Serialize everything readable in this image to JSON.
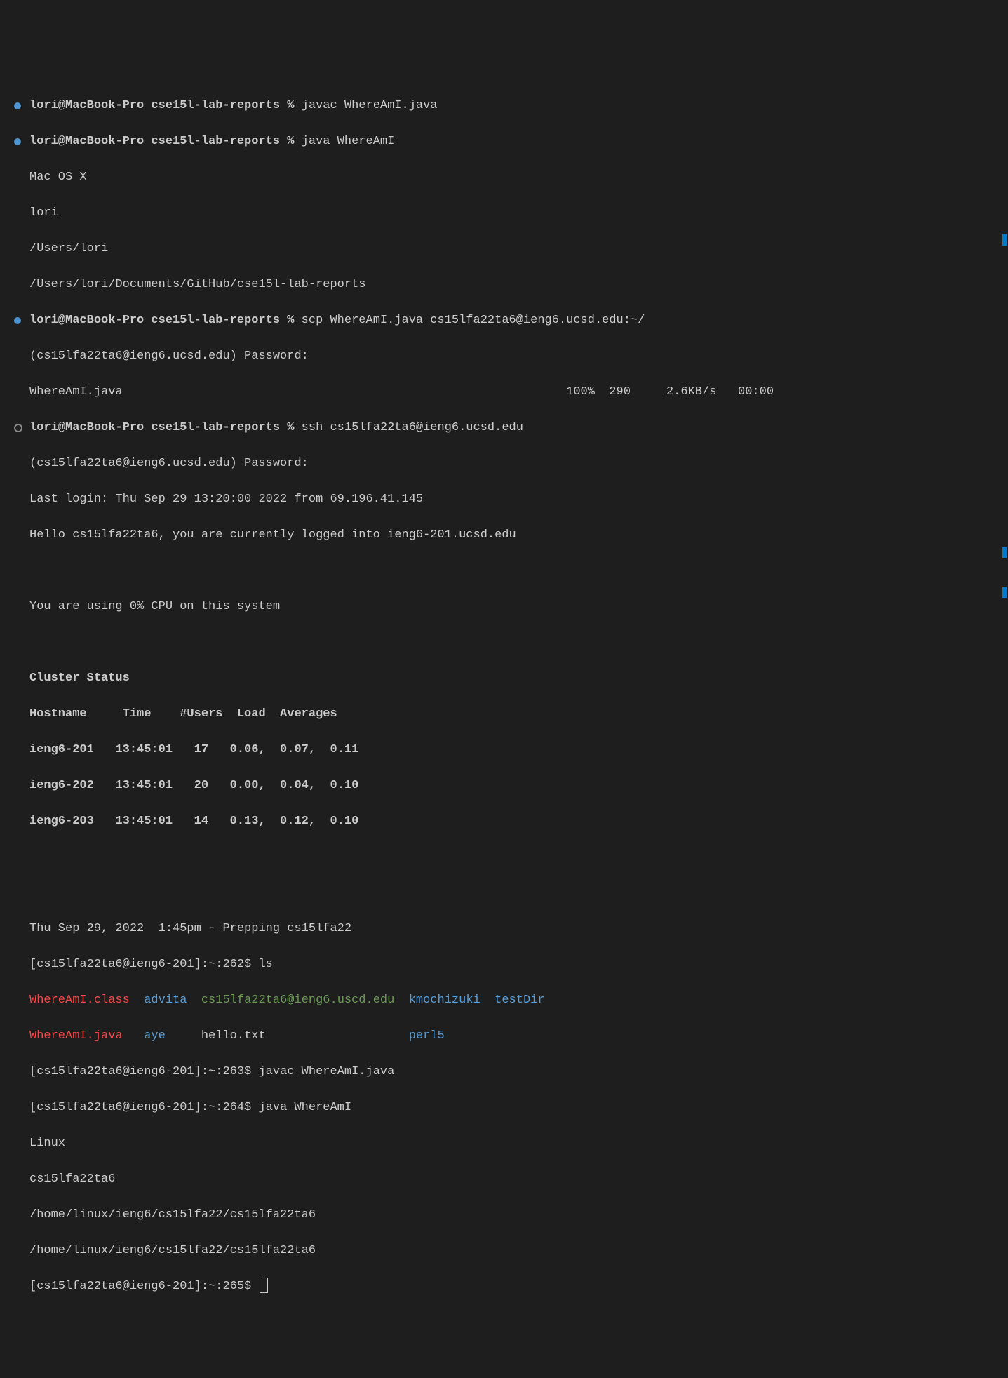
{
  "local_prompt": "lori@MacBook-Pro cse15l-lab-reports %",
  "commands": {
    "javac": "javac WhereAmI.java",
    "java": "java WhereAmI",
    "scp": "scp WhereAmI.java cs15lfa22ta6@ieng6.ucsd.edu:~/",
    "ssh": "ssh cs15lfa22ta6@ieng6.ucsd.edu",
    "ls": "ls",
    "javac2": "javac WhereAmI.java",
    "java2": "java WhereAmI"
  },
  "local_output": {
    "os": "Mac OS X",
    "user": "lori",
    "home": "/Users/lori",
    "cwd": "/Users/lori/Documents/GitHub/cse15l-lab-reports"
  },
  "password_prompt": "(cs15lfa22ta6@ieng6.ucsd.edu) Password:",
  "scp": {
    "file": "WhereAmI.java",
    "percent": "100%",
    "size": "290",
    "rate": "2.6KB/s",
    "time": "00:00"
  },
  "login": {
    "last_login": "Last login: Thu Sep 29 13:20:00 2022 from 69.196.41.145",
    "hello": "Hello cs15lfa22ta6, you are currently logged into ieng6-201.ucsd.edu",
    "cpu": "You are using 0% CPU on this system"
  },
  "cluster": {
    "title": "Cluster Status",
    "header": "Hostname     Time    #Users  Load  Averages",
    "rows": [
      "ieng6-201   13:45:01   17   0.06,  0.07,  0.11",
      "ieng6-202   13:45:01   20   0.00,  0.04,  0.10",
      "ieng6-203   13:45:01   14   0.13,  0.12,  0.10"
    ]
  },
  "motd": "Thu Sep 29, 2022  1:45pm - Prepping cs15lfa22",
  "remote_prompts": {
    "p262": "[cs15lfa22ta6@ieng6-201]:~:262$",
    "p263": "[cs15lfa22ta6@ieng6-201]:~:263$",
    "p264": "[cs15lfa22ta6@ieng6-201]:~:264$",
    "p265": "[cs15lfa22ta6@ieng6-201]:~:265$"
  },
  "ls_output": {
    "col1a": "WhereAmI.class",
    "col1b": "WhereAmI.java",
    "col2a": "advita",
    "col2b": "aye",
    "col3a": "cs15lfa22ta6@ieng6.uscd.edu",
    "col3b": "hello.txt",
    "col4a": "kmochizuki",
    "col4b": "perl5",
    "col5a": "testDir"
  },
  "remote_output": {
    "os": "Linux",
    "user": "cs15lfa22ta6",
    "home": "/home/linux/ieng6/cs15lfa22/cs15lfa22ta6",
    "cwd": "/home/linux/ieng6/cs15lfa22/cs15lfa22ta6"
  },
  "chart_data": {
    "type": "table",
    "title": "Cluster Status",
    "columns": [
      "Hostname",
      "Time",
      "#Users",
      "Load",
      "Averages"
    ],
    "rows": [
      {
        "Hostname": "ieng6-201",
        "Time": "13:45:01",
        "Users": 17,
        "Load": [
          0.06,
          0.07,
          0.11
        ]
      },
      {
        "Hostname": "ieng6-202",
        "Time": "13:45:01",
        "Users": 20,
        "Load": [
          0.0,
          0.04,
          0.1
        ]
      },
      {
        "Hostname": "ieng6-203",
        "Time": "13:45:01",
        "Users": 14,
        "Load": [
          0.13,
          0.12,
          0.1
        ]
      }
    ]
  }
}
